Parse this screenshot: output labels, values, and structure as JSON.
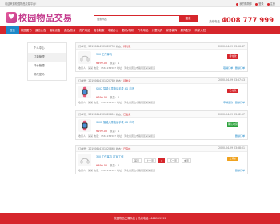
{
  "topbar": {
    "welcome": "欢迎来到校园物品交易平台!",
    "links": [
      "我的购物车",
      "登录",
      "注册"
    ]
  },
  "header": {
    "logo_text": "校园物品交易",
    "search_placeholder": "搜索商品",
    "search_button": "搜索",
    "hotline_label": "热线电话",
    "hotline_number": "4008 777 999"
  },
  "nav": {
    "items": [
      "首页",
      "校园图书",
      "通信公告",
      "智能设备",
      "食品/饮食",
      "洗护用品",
      "箱包鞋服",
      "电脑办公",
      "数码/相机",
      "汽车用品",
      "儿童玩具",
      "家居装饰",
      "服饰配件",
      "商家入驻"
    ],
    "active_index": 0
  },
  "sidebar": {
    "items": [
      "个人中心",
      "订单管理",
      "评价管理",
      "修改密码"
    ],
    "active_index": 1
  },
  "orders": [
    {
      "order_no": "订单号：20190614101520750",
      "status": "待付款",
      "date": "2020-04-29 03:56:47",
      "product": "300 工作耳机",
      "price": "¥399.00",
      "qty": "数量：1",
      "button": "待付款",
      "button_color": "#d6262c",
      "info": "收货人：某某  电话：1561234567  地址：河北省唐山市路南区某某街道",
      "delete": "取消订单 | 删除订单",
      "thumb": "earphone"
    },
    {
      "order_no": "订单号：20190614101520789",
      "status": "待发货",
      "date": "2020-04-29 03:57:13",
      "product": "S502 智能儿童电话手表 4G 手环",
      "price": "¥799.00",
      "qty": "数量：1",
      "button": "已付款",
      "button_color": "#d6262c",
      "info": "收货人：某某  电话：1561234567  地址：河北省唐山市路南区某某街道",
      "delete": "申请退款 | 删除订单",
      "thumb": "watch"
    },
    {
      "order_no": "订单号：20190614101520811",
      "status": "已发货",
      "date": "2020-04-29 03:52:57",
      "product": "S502 智能儿童电话手表 4G 手环",
      "price": "¥199.00",
      "qty": "数量：1",
      "button": "确认收货",
      "button_color": "#2aa13a",
      "info": "收货人：某某  电话：1561234567  地址：河北省唐山市路南区某某街道",
      "delete": "删除订单",
      "thumb": "watch"
    },
    {
      "order_no": "订单号：20190614101520865",
      "status": "已完成",
      "date": "2020-04-29 03:58:01",
      "product": "300 工作耳机 1TB 工作",
      "price": "¥399.00",
      "qty": "数量：1",
      "button": "去评价",
      "button_color": "#f0a21e",
      "info": "收货人：某某  电话：1561234567  地址：河北省唐山市路南区某某街道",
      "delete": "删除订单",
      "thumb": "earphone"
    }
  ],
  "pager": {
    "items": [
      "首页",
      "上一页",
      "1",
      "下一页",
      "末页"
    ],
    "current_index": 2
  },
  "footer": {
    "text": "校园物品交易系统 | 热线电话 4008999999"
  },
  "colors": {
    "brand": "#d6262c",
    "nav_active": "#1e88c8",
    "logo": "#c43a8c"
  }
}
